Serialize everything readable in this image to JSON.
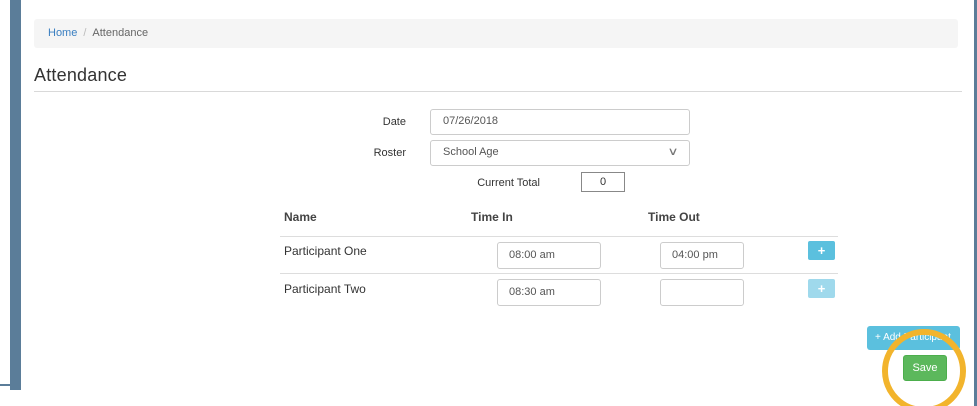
{
  "breadcrumb": {
    "home": "Home",
    "separator": "/",
    "current": "Attendance"
  },
  "page": {
    "title": "Attendance"
  },
  "form": {
    "date_label": "Date",
    "date_value": "07/26/2018",
    "roster_label": "Roster",
    "roster_value": "School Age",
    "current_total_label": "Current Total",
    "current_total_value": "0"
  },
  "table": {
    "headers": {
      "name": "Name",
      "time_in": "Time In",
      "time_out": "Time Out"
    },
    "rows": [
      {
        "name": "Participant One",
        "time_in": "08:00 am",
        "time_out": "04:00 pm",
        "add_enabled": true
      },
      {
        "name": "Participant Two",
        "time_in": "08:30 am",
        "time_out": "",
        "add_enabled": false
      }
    ]
  },
  "actions": {
    "add_participant_label": "+ Add Participant",
    "save_label": "Save",
    "plus_symbol": "+"
  },
  "colors": {
    "accent_blue": "#5bc0de",
    "save_green": "#5cb85c",
    "highlight": "#f2b42c",
    "sidebar": "#5b7d99"
  },
  "icons": {
    "roster_dropdown": "chevron-down-icon",
    "row_action": "plus-icon"
  }
}
